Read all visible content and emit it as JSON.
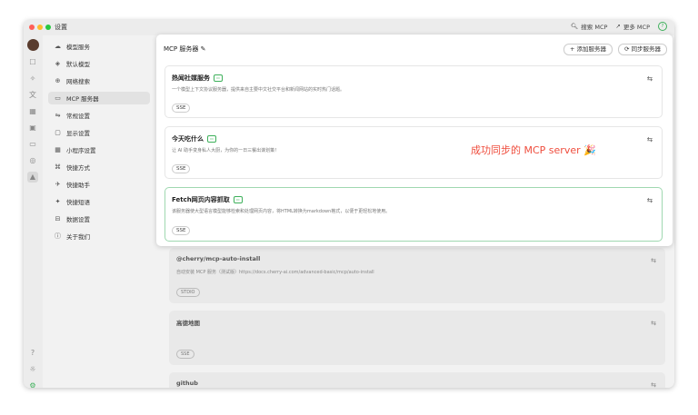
{
  "window": {
    "title": "设置",
    "toolbar": {
      "search_label": "搜索 MCP",
      "more_label": "更多 MCP"
    }
  },
  "sidebar": {
    "items": [
      {
        "label": "模型服务",
        "icon": "cloud-icon"
      },
      {
        "label": "默认模型",
        "icon": "cube-icon"
      },
      {
        "label": "网络搜索",
        "icon": "globe-icon"
      },
      {
        "label": "MCP 服务器",
        "icon": "server-icon"
      },
      {
        "label": "常规设置",
        "icon": "sliders-icon"
      },
      {
        "label": "显示设置",
        "icon": "display-icon"
      },
      {
        "label": "小程序设置",
        "icon": "grid-icon"
      },
      {
        "label": "快捷方式",
        "icon": "command-icon"
      },
      {
        "label": "快捷助手",
        "icon": "rocket-icon"
      },
      {
        "label": "快捷短语",
        "icon": "sparkle-icon"
      },
      {
        "label": "数据设置",
        "icon": "database-icon"
      },
      {
        "label": "关于我们",
        "icon": "info-icon"
      }
    ]
  },
  "panel": {
    "header": "MCP 服务器",
    "add_button": "+ 添加服务器",
    "sync_button": "同步服务器",
    "cards": [
      {
        "name": "热闻社媒服务",
        "desc": "一个模型上下文协议服务器，提供来自主要中文社交平台和新闻网站的实时热门话题。",
        "tag": "SSE"
      },
      {
        "name": "今天吃什么",
        "desc": "让 AI 助手变身私人大厨，为你的一日三餐出谋划策！",
        "tag": "SSE"
      },
      {
        "name": "Fetch网页内容抓取",
        "desc": "该服务器使大型语言模型能够检索和处理网页内容，将HTML转换为markdown格式，以便于更轻松地使用。",
        "tag": "SSE"
      }
    ]
  },
  "background_cards": [
    {
      "name": "@cherry/mcp-auto-install",
      "desc": "自动安装 MCP 服务（测试版）https://docs.cherry-ai.com/advanced-basic/mcp/auto-install",
      "tag": "STDIO"
    },
    {
      "name": "高德地图",
      "desc": "",
      "tag": "SSE"
    },
    {
      "name": "github",
      "desc": "",
      "tag": ""
    }
  ],
  "annotation": "成功同步的 MCP server 🎉",
  "colors": {
    "accent_green": "#3db05a",
    "annotation_red": "#ef4d3d"
  }
}
